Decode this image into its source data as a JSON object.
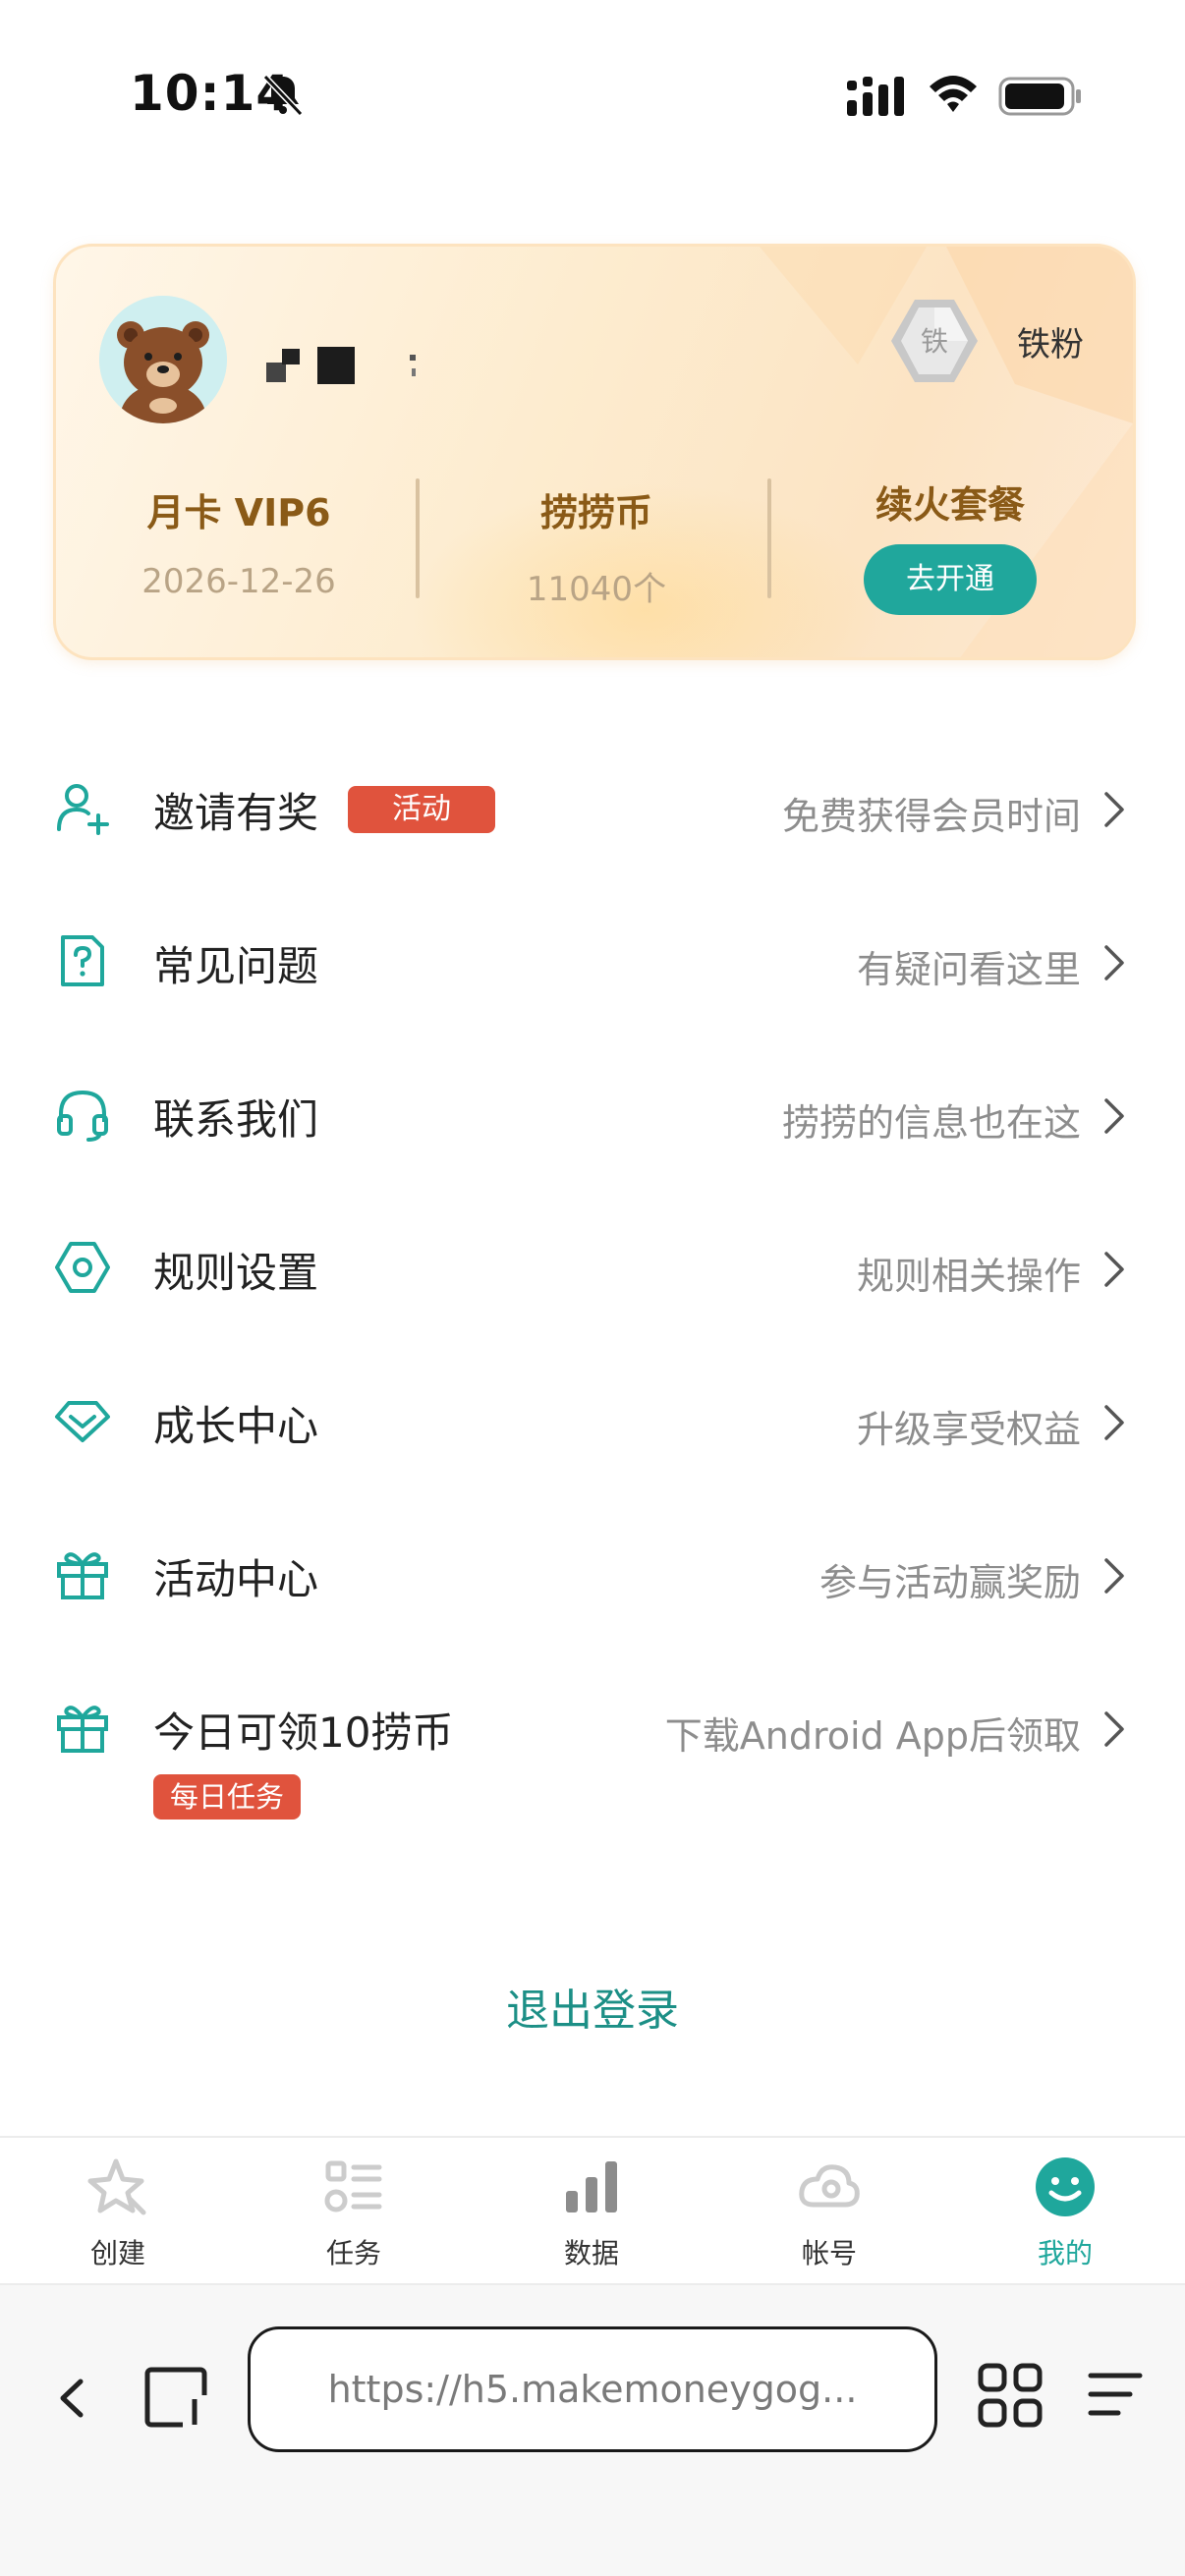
{
  "status_bar": {
    "time": "10:14"
  },
  "member_card": {
    "level_name": "铁粉",
    "level_badge_char": "铁",
    "stats": [
      {
        "title": "月卡 VIP6",
        "value": "2026-12-26"
      },
      {
        "title": "捞捞币",
        "value": "11040个"
      },
      {
        "title": "续火套餐",
        "button": "去开通"
      }
    ]
  },
  "menu": [
    {
      "icon": "user-plus-icon",
      "label": "邀请有奖",
      "tag": "活动",
      "hint": "免费获得会员时间"
    },
    {
      "icon": "question-doc-icon",
      "label": "常见问题",
      "hint": "有疑问看这里"
    },
    {
      "icon": "headset-icon",
      "label": "联系我们",
      "hint": "捞捞的信息也在这"
    },
    {
      "icon": "hexagon-settings-icon",
      "label": "规则设置",
      "hint": "规则相关操作"
    },
    {
      "icon": "diamond-icon",
      "label": "成长中心",
      "hint": "升级享受权益"
    },
    {
      "icon": "gift-icon",
      "label": "活动中心",
      "hint": "参与活动赢奖励"
    },
    {
      "icon": "gift-icon",
      "label": "今日可领10捞币",
      "tag": "每日任务",
      "hint": "下载Android App后领取"
    }
  ],
  "logout_label": "退出登录",
  "tabs": [
    {
      "icon": "star-icon",
      "label": "创建"
    },
    {
      "icon": "task-list-icon",
      "label": "任务"
    },
    {
      "icon": "bar-chart-icon",
      "label": "数据"
    },
    {
      "icon": "cloud-account-icon",
      "label": "帐号"
    },
    {
      "icon": "smile-icon",
      "label": "我的",
      "active": true
    }
  ],
  "browser": {
    "url": "https://h5.makemoneygog..."
  },
  "colors": {
    "accent": "#1fa79c",
    "tag_red": "#e0533d",
    "gold_text": "#8a5a17"
  }
}
